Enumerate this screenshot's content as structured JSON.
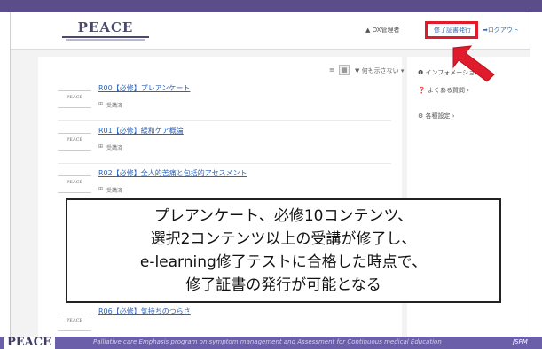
{
  "header": {
    "logo": "PEACE",
    "nav_mypage": "▲ OX管理者",
    "nav_certificate": "修了証書発行",
    "nav_logout": "➡ログアウト"
  },
  "toolbar": {
    "list_view_icon": "≡",
    "grid_view_icon": "▦",
    "filter_label": "▼ 何も示さない ▾"
  },
  "courses": [
    {
      "title": "R00【必修】プレアンケート",
      "tag": "受講済"
    },
    {
      "title": "R01【必修】緩和ケア概論",
      "tag": "受講済"
    },
    {
      "title": "R02【必修】全人的苦痛と包括的アセスメント",
      "tag": "受講済"
    },
    {
      "title": "R06【必修】気持ちのつらさ",
      "tag": ""
    }
  ],
  "thumbnail_text": "PEACE",
  "tag_icon": "⊞",
  "sidebar": {
    "items": [
      {
        "label": "❶ インフォメーション"
      },
      {
        "label": "❓ よくある質問 ›"
      },
      {
        "label": "⚙ 各種設定 ›"
      }
    ]
  },
  "callout": {
    "lines": [
      "プレアンケート、必修10コンテンツ、",
      "選択2コンテンツ以上の受講が修了し、",
      "e-learning修了テストに合格した時点で、",
      "修了証書の発行が可能となる"
    ]
  },
  "footer": {
    "logo": "PEACE",
    "tagline": "Palliative care Emphasis program on symptom management and Assessment for Continuous medical Education",
    "mark": "JSPM"
  },
  "colors": {
    "accent_red": "#e01b2b",
    "brand_purple": "#5b4d8a",
    "link_blue": "#2e63b5"
  }
}
